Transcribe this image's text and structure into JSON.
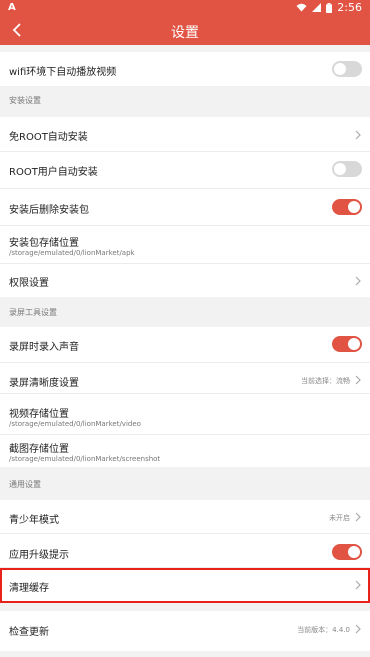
{
  "status_bar": {
    "app_icon": "A",
    "time": "2:56",
    "icons": [
      "wifi-icon",
      "signal-icon",
      "battery-icon"
    ]
  },
  "header": {
    "title": "设置",
    "back_icon": "chevron-left-icon"
  },
  "rows": {
    "wifi_autoplay": {
      "label": "wifi环境下自动播放视频",
      "toggle": false
    },
    "install_section": "安装设置",
    "root_free_install": {
      "label": "免ROOT自动安装"
    },
    "root_user_install": {
      "label": "ROOT用户自动安装",
      "toggle": false
    },
    "delete_after_install": {
      "label": "安装后删除安装包",
      "toggle": true
    },
    "package_storage": {
      "label": "安装包存储位置",
      "path": "/storage/emulated/0/lionMarket/apk"
    },
    "permission_settings": {
      "label": "权限设置"
    },
    "record_section": "录屏工具设置",
    "record_audio": {
      "label": "录屏时录入声音",
      "toggle": true
    },
    "record_quality": {
      "label": "录屏清晰度设置",
      "value": "当前选择：流畅"
    },
    "video_storage": {
      "label": "视频存储位置",
      "path": "/storage/emulated/0/lionMarket/video"
    },
    "screenshot_storage": {
      "label": "截图存储位置",
      "path": "/storage/emulated/0/lionMarket/screenshot"
    },
    "general_section": "通用设置",
    "youth_mode": {
      "label": "青少年模式",
      "value": "未开启"
    },
    "upgrade_hint": {
      "label": "应用升级提示",
      "toggle": true
    },
    "clear_cache": {
      "label": "清理缓存"
    },
    "check_update": {
      "label": "检查更新",
      "value": "当前版本：4.4.0"
    }
  },
  "colors": {
    "accent": "#e15444",
    "highlight": "#e8211a"
  }
}
